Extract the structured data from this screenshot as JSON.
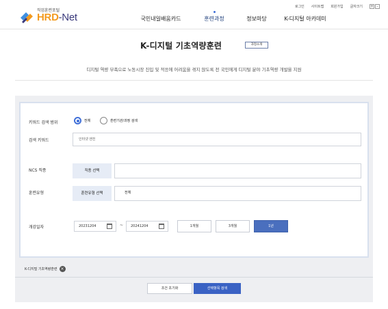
{
  "header": {
    "util_links": [
      "로그인",
      "사이트맵",
      "회원가입",
      "글자크기"
    ],
    "zoom": [
      "+",
      "-"
    ],
    "logo": {
      "small": "직업훈련포털",
      "hrd": "HRD",
      "net": "-Net"
    },
    "nav": [
      {
        "label": "국민내일배움카드",
        "active": false
      },
      {
        "label": "훈련과정",
        "active": true
      },
      {
        "label": "정보마당",
        "active": false
      },
      {
        "label": "K-디지털 아카데미",
        "active": false
      }
    ]
  },
  "page": {
    "title": "K-디지털 기초역량훈련",
    "intro_button": "과정소개",
    "description": "디지털 역량 부족으로 노동시장 진입 및 적응에 어려움을 겪지 않도록 전 국민에게 디지털 분야 기초역량 개발을 지원"
  },
  "form": {
    "keyword_scope": {
      "label": "키워드 검색 범위",
      "options": [
        {
          "label": "전체",
          "selected": true
        },
        {
          "label": "훈련기관/과정 검색",
          "selected": false
        }
      ]
    },
    "keyword": {
      "label": "검색 키워드",
      "placeholder": "인터넷 엔진"
    },
    "ncs": {
      "label": "NCS 직종",
      "button": "직종 선택",
      "value": ""
    },
    "training_type": {
      "label": "훈련유형",
      "button": "훈련유형 선택",
      "value": "전체"
    },
    "start_date": {
      "label": "개강일자",
      "from": "20231204",
      "separator": "~",
      "to": "20241204",
      "periods": [
        {
          "label": "1개월",
          "active": false
        },
        {
          "label": "3개월",
          "active": false
        },
        {
          "label": "1년",
          "active": true
        }
      ]
    }
  },
  "filters": {
    "chip": "K-디지털 기초역량훈련"
  },
  "actions": {
    "reset": "조건 초기화",
    "search": "선택항목 검색"
  },
  "colors": {
    "accent": "#3a62c4",
    "logo_orange": "#f39a1e",
    "logo_navy": "#3a3a7c"
  }
}
